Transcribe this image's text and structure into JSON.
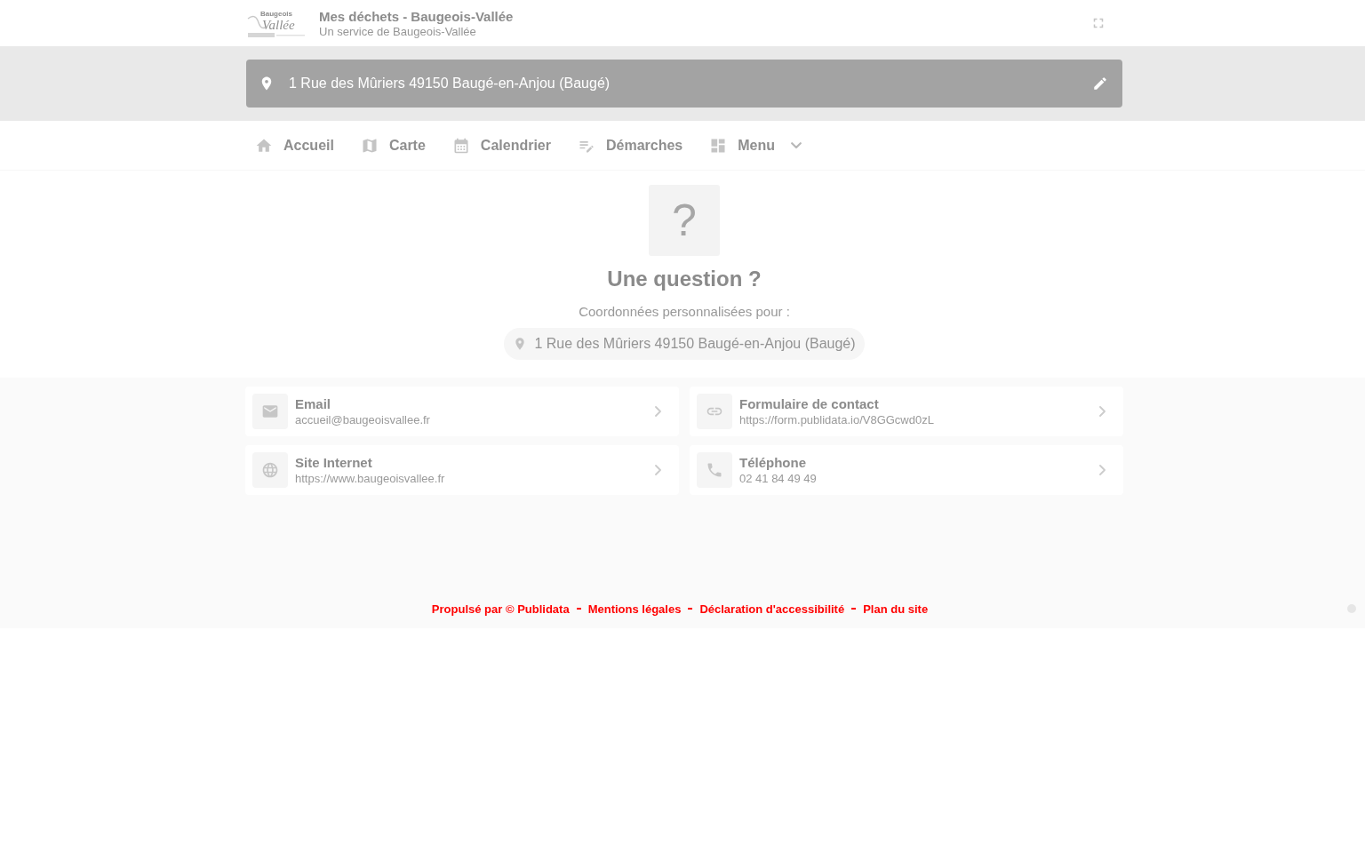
{
  "header": {
    "logo": {
      "line_1": "Baugeois",
      "line_2": "Vallée"
    },
    "title": "Mes déchets - Baugeois-Vallée",
    "subtitle": "Un service de Baugeois-Vallée"
  },
  "address_bar": {
    "value": "1 Rue des Mûriers 49150 Baugé-en-Anjou (Baugé)"
  },
  "nav": [
    {
      "label": "Accueil",
      "kind": "link"
    },
    {
      "label": "Carte",
      "kind": "link"
    },
    {
      "label": "Calendrier",
      "kind": "link"
    },
    {
      "label": "Démarches",
      "kind": "link"
    },
    {
      "label": "Menu",
      "kind": "dropdown"
    }
  ],
  "contact": {
    "glyph": "?",
    "title": "Une question ?",
    "intro": "Coordonnées personnalisées pour :",
    "address": "1 Rue des Mûriers 49150 Baugé-en-Anjou (Baugé)"
  },
  "contact_cards": [
    {
      "title": "Email",
      "value": "accueil@baugeoisvallee.fr"
    },
    {
      "title": "Formulaire de contact",
      "value": "https://form.publidata.io/V8GGcwd0zL"
    },
    {
      "title": "Site Internet",
      "value": "https://www.baugeoisvallee.fr"
    },
    {
      "title": "Téléphone",
      "value": "02 41 84 49 49"
    }
  ],
  "footer": {
    "links": [
      "Propulsé par © Publidata",
      "Mentions légales",
      "Déclaration d'accessibilité",
      "Plan du site"
    ]
  }
}
